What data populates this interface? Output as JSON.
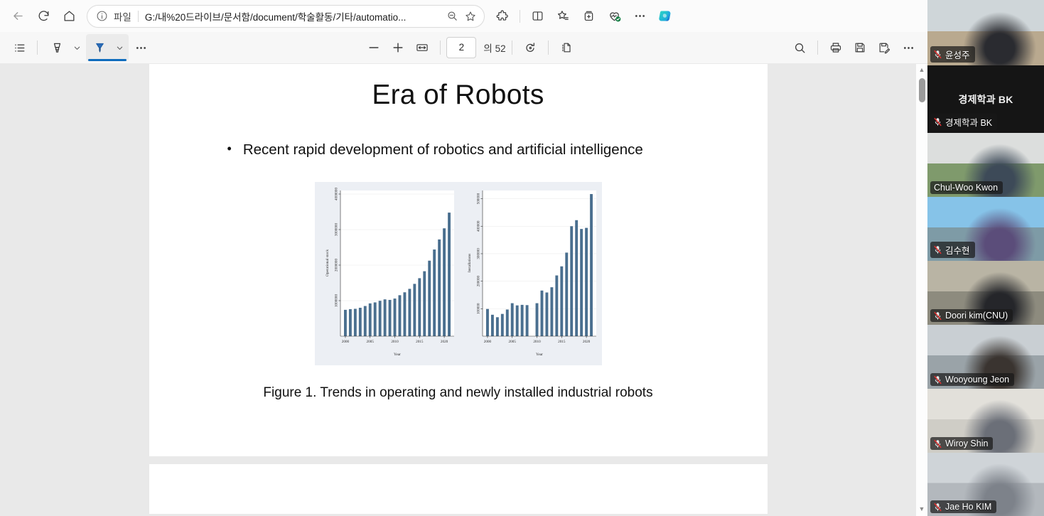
{
  "browser": {
    "nav": {
      "back_label": "Back",
      "refresh_label": "Refresh",
      "home_label": "Home"
    },
    "omnibox": {
      "scheme_label": "파일",
      "url": "G:/내%20드라이브/문서함/document/학술활동/기타/automatio...",
      "zoom_out_label": "Zoom out",
      "favorite_label": "Add to favorites"
    },
    "actions": {
      "extensions_label": "Extensions",
      "split_label": "Split screen",
      "favorites_label": "Favorites",
      "collections_label": "Collections",
      "essentials_label": "Browser essentials",
      "settings_label": "Settings and more",
      "copilot_label": "Copilot"
    }
  },
  "pdf_toolbar": {
    "contents_label": "Table of contents",
    "highlight_label": "Highlight",
    "highlight_caret_label": "Highlight options",
    "draw_label": "Draw",
    "draw_caret_label": "Draw options",
    "more_tools_label": "More tools",
    "zoom_out_label": "Zoom out",
    "zoom_in_label": "Zoom in",
    "fit_page_label": "Fit to page",
    "current_page": "2",
    "page_total": "의 52",
    "rotate_label": "Rotate",
    "page_view_label": "Page view",
    "search_label": "Find",
    "print_label": "Print",
    "save_label": "Save",
    "save_as_label": "Save as",
    "more_label": "More options"
  },
  "document": {
    "title": "Era of Robots",
    "bullet_marker": "•",
    "bullet_text": "Recent rapid development of robotics and artificial intelligence",
    "caption": "Figure 1. Trends in operating and newly installed industrial robots"
  },
  "chart_data": [
    {
      "type": "bar",
      "title": "",
      "xlabel": "Year",
      "ylabel": "Operational stock",
      "xlim": [
        1999,
        2022
      ],
      "ylim": [
        0,
        4100000
      ],
      "yticks": [
        1000000,
        2000000,
        3000000,
        4000000
      ],
      "ytick_labels": [
        "1000000",
        "2000000",
        "3000000",
        "4000000"
      ],
      "xticks": [
        2000,
        2005,
        2010,
        2015,
        2020
      ],
      "xtick_labels": [
        "2000",
        "2005",
        "2010",
        "2015",
        "2020"
      ],
      "grid": true,
      "bar_color": "#4a6f8f",
      "x": [
        2000,
        2001,
        2002,
        2003,
        2004,
        2005,
        2006,
        2007,
        2008,
        2009,
        2010,
        2011,
        2012,
        2013,
        2014,
        2015,
        2016,
        2017,
        2018,
        2019,
        2020,
        2021
      ],
      "values": [
        742000,
        760000,
        770000,
        800000,
        849000,
        923000,
        951000,
        996000,
        1036000,
        1021000,
        1059000,
        1153000,
        1235000,
        1332000,
        1472000,
        1632000,
        1828000,
        2125000,
        2439000,
        2722000,
        3035000,
        3477000
      ]
    },
    {
      "type": "bar",
      "title": "",
      "xlabel": "Year",
      "ylabel": "Installations",
      "xlim": [
        1999,
        2022
      ],
      "ylim": [
        0,
        530000
      ],
      "yticks": [
        100000,
        200000,
        300000,
        400000,
        500000
      ],
      "ytick_labels": [
        "100000",
        "200000",
        "300000",
        "400000",
        "500000"
      ],
      "xticks": [
        2000,
        2005,
        2010,
        2015,
        2020
      ],
      "xtick_labels": [
        "2000",
        "2005",
        "2010",
        "2015",
        "2020"
      ],
      "grid": true,
      "bar_color": "#4a6f8f",
      "x": [
        2000,
        2001,
        2002,
        2003,
        2004,
        2005,
        2006,
        2007,
        2008,
        2010,
        2011,
        2012,
        2013,
        2014,
        2015,
        2016,
        2017,
        2018,
        2019,
        2020,
        2021
      ],
      "values": [
        99000,
        78000,
        69000,
        81000,
        97000,
        120000,
        112000,
        114000,
        113000,
        120000,
        166000,
        159000,
        178000,
        221000,
        254000,
        304000,
        400000,
        422000,
        390000,
        394000,
        517000
      ]
    }
  ],
  "meeting": {
    "participants": [
      {
        "name": "윤성주",
        "muted": true,
        "camera_on": true,
        "speaking": false,
        "height": 92
      },
      {
        "name": "경제학과 BK",
        "muted": true,
        "camera_on": false,
        "speaking": false,
        "height": 95,
        "centered_name": "경제학과 BK"
      },
      {
        "name": "Chul-Woo Kwon",
        "muted": false,
        "camera_on": true,
        "speaking": true,
        "height": 90
      },
      {
        "name": "김수현",
        "muted": true,
        "camera_on": true,
        "speaking": false,
        "height": 90
      },
      {
        "name": "Doori kim(CNU)",
        "muted": true,
        "camera_on": true,
        "speaking": false,
        "height": 90
      },
      {
        "name": "Wooyoung Jeon",
        "muted": true,
        "camera_on": true,
        "speaking": false,
        "height": 90
      },
      {
        "name": "Wiroy Shin",
        "muted": true,
        "camera_on": true,
        "speaking": false,
        "height": 90
      },
      {
        "name": "Jae Ho KIM",
        "muted": true,
        "camera_on": true,
        "speaking": false,
        "height": 89
      }
    ]
  },
  "colors": {
    "accent": "#0f6cbd",
    "speaking_border": "#4aeba0",
    "bar": "#4a6f8f",
    "chart_bg": "#eceff4"
  }
}
